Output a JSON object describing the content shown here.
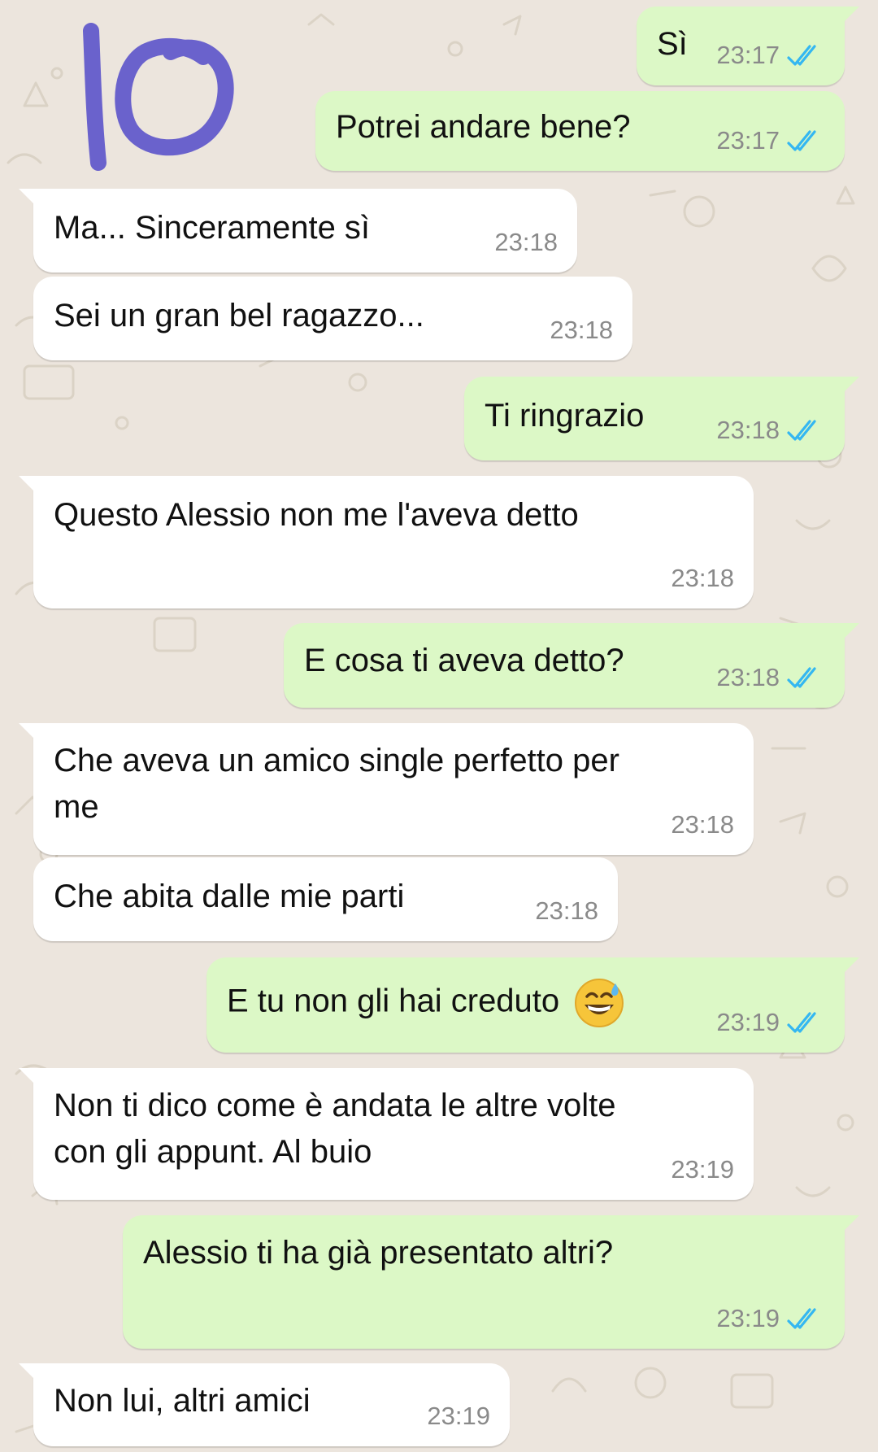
{
  "overlay": {
    "label": "IO",
    "color": "#6a62cc"
  },
  "colors": {
    "outgoing": "#dcf8c6",
    "incoming": "#ffffff",
    "background": "#ece5dd",
    "read_tick": "#34b7f1"
  },
  "messages": [
    {
      "dir": "out",
      "text": "Sì",
      "time": "23:17",
      "ticks": "read-double-tick"
    },
    {
      "dir": "out",
      "text": "Potrei andare bene?",
      "time": "23:17",
      "ticks": "read-double-tick"
    },
    {
      "dir": "in",
      "text": "Ma... Sinceramente sì",
      "time": "23:18"
    },
    {
      "dir": "in",
      "text": "Sei un gran bel ragazzo...",
      "time": "23:18"
    },
    {
      "dir": "out",
      "text": "Ti ringrazio",
      "time": "23:18",
      "ticks": "read-double-tick"
    },
    {
      "dir": "in",
      "text": "Questo Alessio non me l'aveva detto",
      "time": "23:18"
    },
    {
      "dir": "out",
      "text": "E cosa ti aveva detto?",
      "time": "23:18",
      "ticks": "read-double-tick"
    },
    {
      "dir": "in",
      "text_lines": [
        "Che aveva un amico single perfetto per",
        "me"
      ],
      "time": "23:18"
    },
    {
      "dir": "in",
      "text": "Che abita dalle mie parti",
      "time": "23:18"
    },
    {
      "dir": "out",
      "text": "E tu non gli hai creduto",
      "emoji": "grinning-sweat-emoji",
      "time": "23:19",
      "ticks": "read-double-tick"
    },
    {
      "dir": "in",
      "text_lines": [
        "Non ti dico come è andata le altre volte",
        "con gli appunt. Al buio"
      ],
      "time": "23:19"
    },
    {
      "dir": "out",
      "text": "Alessio ti ha già presentato altri?",
      "time": "23:19",
      "ticks": "read-double-tick"
    },
    {
      "dir": "in",
      "text": "Non lui, altri amici",
      "time": "23:19"
    }
  ]
}
